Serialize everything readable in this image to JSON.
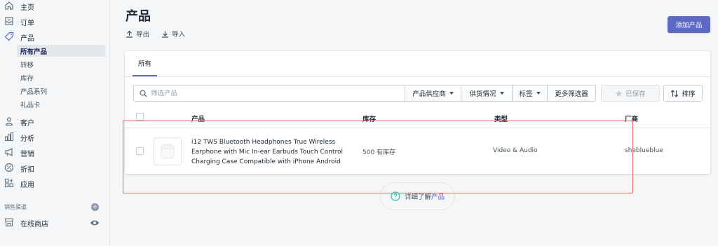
{
  "sidebar": {
    "items": [
      {
        "label": "主页",
        "icon": "home-icon"
      },
      {
        "label": "订单",
        "icon": "orders-icon"
      },
      {
        "label": "产品",
        "icon": "tag-icon"
      }
    ],
    "product_subitems": [
      {
        "label": "所有产品",
        "active": true
      },
      {
        "label": "转移"
      },
      {
        "label": "库存"
      },
      {
        "label": "产品系列"
      },
      {
        "label": "礼品卡"
      }
    ],
    "items2": [
      {
        "label": "客户",
        "icon": "customer-icon"
      },
      {
        "label": "分析",
        "icon": "analytics-icon"
      },
      {
        "label": "营销",
        "icon": "megaphone-icon"
      },
      {
        "label": "折扣",
        "icon": "discount-icon"
      },
      {
        "label": "应用",
        "icon": "apps-icon"
      }
    ],
    "sales_channels_label": "销售渠道",
    "online_store_label": "在线商店"
  },
  "header": {
    "title": "产品",
    "export_label": "导出",
    "import_label": "导入",
    "add_product_label": "添加产品"
  },
  "tabs": [
    {
      "label": "所有"
    }
  ],
  "filters": {
    "search_placeholder": "筛选产品",
    "vendor_label": "产品供应商",
    "availability_label": "供货情况",
    "tags_label": "标签",
    "more_filters_label": "更多筛选器",
    "saved_label": "已保存",
    "sort_label": "排序"
  },
  "table": {
    "headers": {
      "product": "产品",
      "inventory": "库存",
      "type": "类型",
      "vendor": "厂商"
    },
    "rows": [
      {
        "name": "i12 TWS Bluetooth Headphones True Wireless Earphone with Mic In-ear Earbuds Touch Control Charging Case Compatible with iPhone Android",
        "inventory": "500 有库存",
        "type": "Video & Audio",
        "vendor": "sheblueblue"
      }
    ]
  },
  "learn_more": {
    "prefix": "详细了解",
    "link": "产品"
  },
  "colors": {
    "accent": "#5c6ac4",
    "highlight_box": "#e06666"
  }
}
